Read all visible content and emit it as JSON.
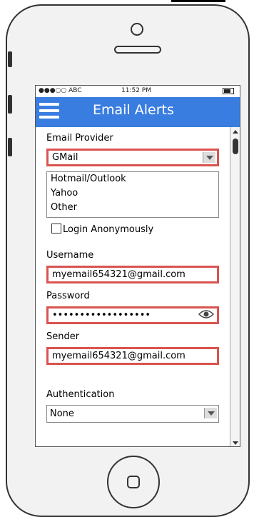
{
  "status_bar": {
    "carrier": "●●●○○ ABC",
    "time": "11:52 PM"
  },
  "header": {
    "title": "Email Alerts"
  },
  "form": {
    "email_provider": {
      "label": "Email Provider",
      "selected": "GMail",
      "options": [
        "Hotmail/Outlook",
        "Yahoo",
        "Other"
      ]
    },
    "login_anonymously": {
      "label": "Login Anonymously",
      "checked": false
    },
    "username": {
      "label": "Username",
      "value": "myemail654321@gmail.com"
    },
    "password": {
      "label": "Password",
      "value": "••••••••••••••••••"
    },
    "sender": {
      "label": "Sender",
      "value": "myemail654321@gmail.com"
    },
    "authentication": {
      "label": "Authentication",
      "selected": "None"
    }
  },
  "colors": {
    "header_bg": "#3a7de0",
    "highlight_border": "#d9534f"
  },
  "icons": [
    "hamburger-menu-icon",
    "dropdown-arrow-icon",
    "eye-icon",
    "battery-icon"
  ]
}
